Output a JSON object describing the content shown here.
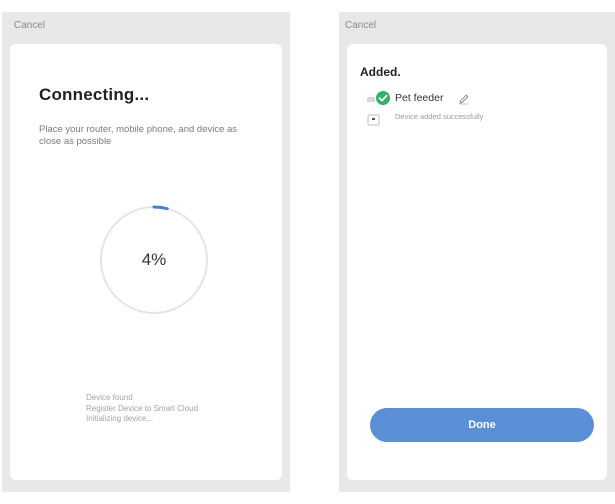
{
  "connecting_screen": {
    "cancel_label": "Cancel",
    "title": "Connecting...",
    "subtitle": "Place your router, mobile phone, and device as close as possible",
    "progress_percent": 4,
    "progress_label": "4%",
    "status_lines": [
      "Device found",
      "Register Device to Smart Cloud",
      "Initializing device..."
    ],
    "accent_color": "#4a7fd0"
  },
  "added_screen": {
    "cancel_label": "Cancel",
    "title": "Added.",
    "device": {
      "name": "Pet feeder",
      "status": "Device added successfully",
      "icon": "check-icon",
      "edit_icon": "pencil-icon"
    },
    "done_label": "Done",
    "button_color": "#5b8fd6",
    "check_color": "#2fb36a"
  }
}
